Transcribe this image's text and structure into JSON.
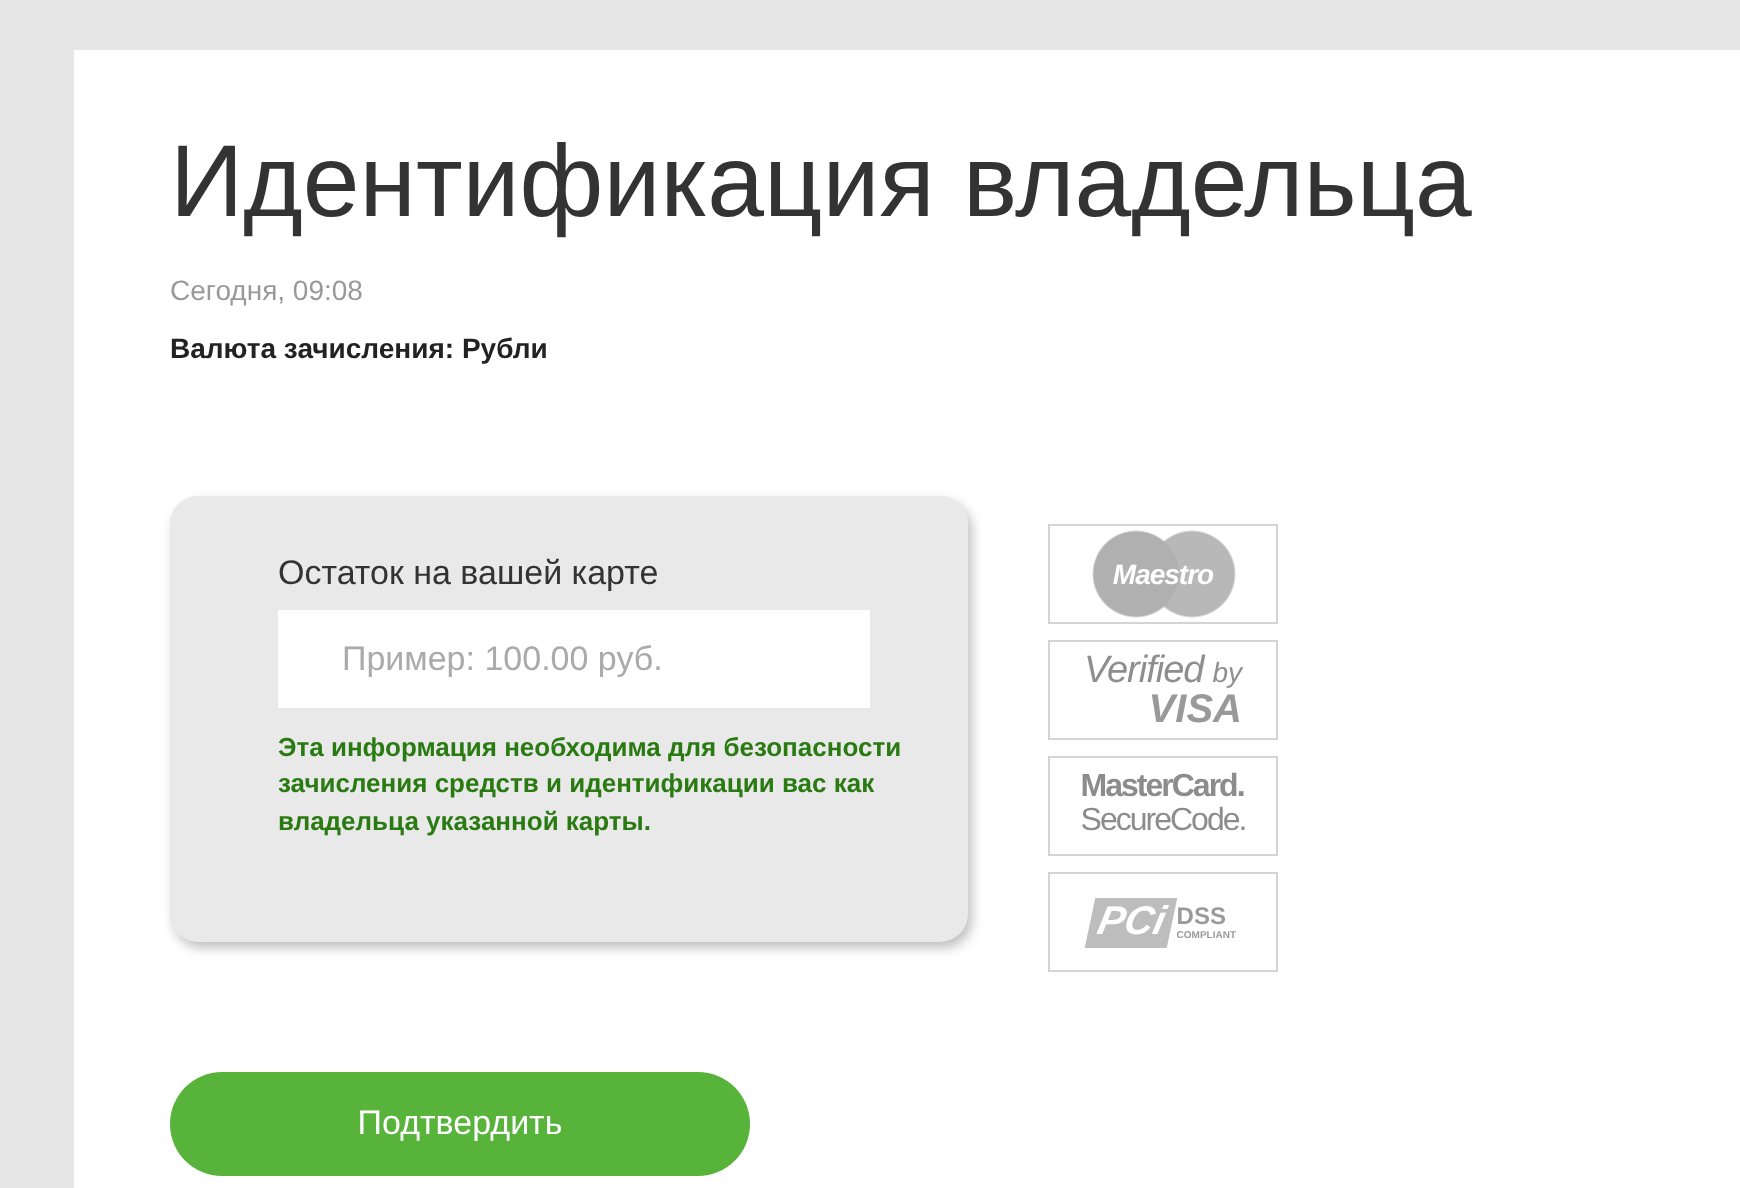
{
  "page": {
    "title": "Идентификация владельца",
    "date": "Сегодня, 09:08",
    "currency": "Валюта зачисления: Рубли"
  },
  "card": {
    "label": "Остаток на вашей карте",
    "input": {
      "placeholder": "Пример: 100.00 руб."
    },
    "note": "Эта информация необходима для безопасности зачисления средств и идентификации вас как владельца указанной карты."
  },
  "badges": [
    {
      "kind": "maestro",
      "lines": [
        "Maestro"
      ]
    },
    {
      "kind": "verified",
      "lines": [
        "Verified",
        "by",
        "VISA"
      ]
    },
    {
      "kind": "securecode",
      "lines": [
        "MasterCard.",
        "SecureCode."
      ]
    },
    {
      "kind": "pci",
      "lines": [
        "PCi",
        "DSS",
        "COMPLIANT"
      ]
    }
  ],
  "button": {
    "label": "Подтвердить"
  }
}
